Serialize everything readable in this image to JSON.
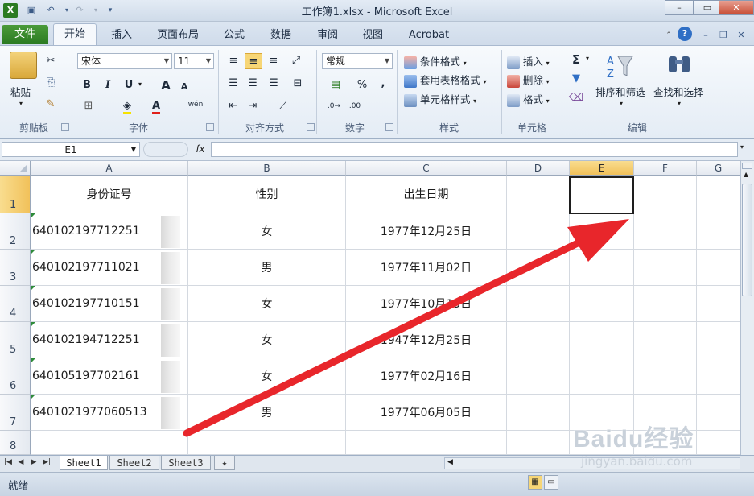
{
  "window": {
    "title": "工作簿1.xlsx - Microsoft Excel",
    "controls": {
      "minimize": "–",
      "restore": "▭",
      "close": "✕"
    }
  },
  "qat": {
    "undo_icon": "undo-icon",
    "redo_icon": "redo-icon"
  },
  "ribbon_tabs": [
    "文件",
    "开始",
    "插入",
    "页面布局",
    "公式",
    "数据",
    "审阅",
    "视图",
    "Acrobat"
  ],
  "ribbon": {
    "clipboard": {
      "paste": "粘贴",
      "label": "剪贴板"
    },
    "font": {
      "name": "宋体",
      "size": "11",
      "bold": "B",
      "italic": "I",
      "underline": "U",
      "grow": "A",
      "shrink": "A",
      "color": "A",
      "phonetic": "wén",
      "label": "字体"
    },
    "alignment": {
      "label": "对齐方式"
    },
    "number": {
      "format": "常规",
      "percent": "%",
      "comma": ",",
      "label": "数字"
    },
    "styles": {
      "conditional": "条件格式",
      "table": "套用表格格式",
      "cell_styles": "单元格样式",
      "label": "样式"
    },
    "cells": {
      "insert": "插入",
      "delete": "删除",
      "format": "格式",
      "label": "单元格"
    },
    "editing": {
      "sum": "Σ",
      "sort": "排序和筛选",
      "find": "查找和选择",
      "label": "编辑"
    }
  },
  "formula_bar": {
    "name_box": "E1",
    "fx": "fx",
    "value": ""
  },
  "columns": [
    "A",
    "B",
    "C",
    "D",
    "E",
    "F",
    "G"
  ],
  "rows": [
    "1",
    "2",
    "3",
    "4",
    "5",
    "6",
    "7",
    "8"
  ],
  "header_row": {
    "a": "身份证号",
    "b": "性别",
    "c": "出生日期"
  },
  "data_rows": [
    {
      "a": "640102197712251",
      "b": "女",
      "c": "1977年12月25日"
    },
    {
      "a": "640102197711021",
      "b": "男",
      "c": "1977年11月02日"
    },
    {
      "a": "640102197710151",
      "b": "女",
      "c": "1977年10月15日"
    },
    {
      "a": "640102194712251",
      "b": "女",
      "c": "1947年12月25日"
    },
    {
      "a": "640105197702161",
      "b": "女",
      "c": "1977年02月16日"
    },
    {
      "a": "6401021977060513",
      "b": "男",
      "c": "1977年06月05日"
    }
  ],
  "selected_cell": "E1",
  "sheets": [
    "Sheet1",
    "Sheet2",
    "Sheet3"
  ],
  "active_sheet": "Sheet1",
  "status": {
    "mode": "就绪"
  },
  "watermark": {
    "brand": "Baidu经验",
    "url": "jingyan.baidu.com"
  },
  "colors": {
    "accent_green": "#2b7b22",
    "selection_header": "#f1c15a",
    "arrow": "#e8262b"
  }
}
